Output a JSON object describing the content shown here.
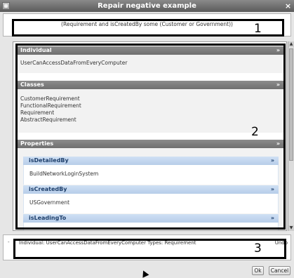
{
  "window": {
    "title": "Repair negative example",
    "close_symbol": "×"
  },
  "expression": "(Requirement and isCreatedBy some (Customer or Government))",
  "markers": [
    "1",
    "2",
    "3"
  ],
  "sections": {
    "individual": {
      "title": "Individual",
      "values": [
        "UserCanAccessDataFromEveryComputer"
      ]
    },
    "classes": {
      "title": "Classes",
      "values": [
        "CustomerRequirement",
        "FunctionalRequirement",
        "Requirement",
        "AbstractRequirement"
      ]
    },
    "properties": {
      "title": "Properties",
      "items": [
        {
          "name": "isDetailedBy",
          "value": "BuildNetworkLoginSystem"
        },
        {
          "name": "isCreatedBy",
          "value": "USGovernment"
        },
        {
          "name": "isLeadingTo",
          "value": ""
        }
      ]
    }
  },
  "chevron_symbol": "»",
  "explanation": {
    "text": "Individual: UserCanAccessDataFromEveryComputer Types: Requirement",
    "undo_label": "Undo"
  },
  "buttons": {
    "ok": "Ok",
    "cancel": "Cancel"
  }
}
